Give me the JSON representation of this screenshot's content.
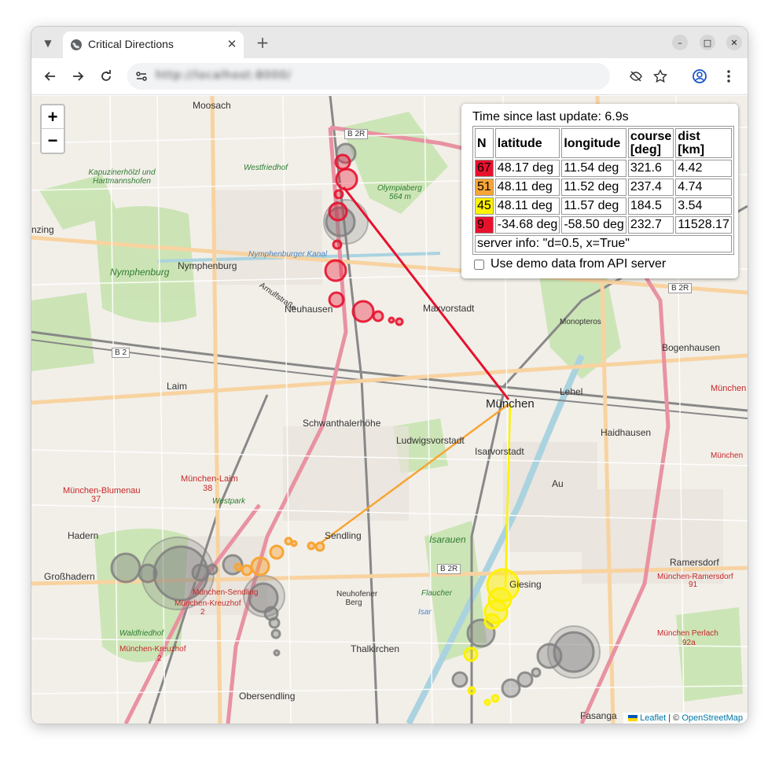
{
  "browser": {
    "tab_title": "Critical Directions",
    "url": "http://localhost:8000/"
  },
  "map": {
    "zoom_in": "+",
    "zoom_out": "−",
    "labels": [
      {
        "id": "moosach",
        "text": "Moosach",
        "cls": ""
      },
      {
        "id": "b2r-top",
        "text": "B 2R",
        "cls": "badge"
      },
      {
        "id": "westfriedhof",
        "text": "Westfriedhof",
        "cls": "park"
      },
      {
        "id": "kapuziner",
        "text": "Kapuzinerhölzl und Hartmannshofen",
        "cls": "park"
      },
      {
        "id": "olympiaberg",
        "text": "Olympiaberg",
        "cls": "park"
      },
      {
        "id": "olympiaberg-h",
        "text": "564 m",
        "cls": "park"
      },
      {
        "id": "nzing",
        "text": "nzing",
        "cls": ""
      },
      {
        "id": "nymphenburg",
        "text": "Nymphenburg",
        "cls": "city"
      },
      {
        "id": "nymphenburg-park",
        "text": "Nymphenburg",
        "cls": "park"
      },
      {
        "id": "nymph-kanal",
        "text": "Nymphenburger Kanal",
        "cls": "water"
      },
      {
        "id": "neuhausen",
        "text": "Neuhausen",
        "cls": ""
      },
      {
        "id": "arnulf",
        "text": "Arnulfstraße",
        "cls": ""
      },
      {
        "id": "maxvorstadt",
        "text": "Maxvorstadt",
        "cls": ""
      },
      {
        "id": "monopteros",
        "text": "Monopteros",
        "cls": ""
      },
      {
        "id": "b2r-right",
        "text": "B 2R",
        "cls": "badge"
      },
      {
        "id": "bogenhausen",
        "text": "Bogenhausen",
        "cls": ""
      },
      {
        "id": "b2",
        "text": "B 2",
        "cls": "badge"
      },
      {
        "id": "lehel",
        "text": "Lehel",
        "cls": ""
      },
      {
        "id": "muenchen-r",
        "text": "München",
        "cls": "rail"
      },
      {
        "id": "laim",
        "text": "Laim",
        "cls": ""
      },
      {
        "id": "muenchen",
        "text": "München",
        "cls": "city"
      },
      {
        "id": "schwanthaler",
        "text": "Schwanthalerhöhe",
        "cls": ""
      },
      {
        "id": "haidhausen",
        "text": "Haidhausen",
        "cls": ""
      },
      {
        "id": "ludwigsvorstadt",
        "text": "Ludwigsvorstadt",
        "cls": ""
      },
      {
        "id": "isarvorstadt",
        "text": "Isarvorstadt",
        "cls": ""
      },
      {
        "id": "au",
        "text": "Au",
        "cls": ""
      },
      {
        "id": "muenchen-laim",
        "text": "München-Laim",
        "cls": "rail"
      },
      {
        "id": "laim-38",
        "text": "38",
        "cls": "rail"
      },
      {
        "id": "westpark",
        "text": "Westpark",
        "cls": "park"
      },
      {
        "id": "blumenau",
        "text": "München-Blumenau",
        "cls": "rail"
      },
      {
        "id": "blumenau-37",
        "text": "37",
        "cls": "rail"
      },
      {
        "id": "hadern",
        "text": "Hadern",
        "cls": ""
      },
      {
        "id": "sendling",
        "text": "Sendling",
        "cls": ""
      },
      {
        "id": "isarauen",
        "text": "Isarauen",
        "cls": "park"
      },
      {
        "id": "grosshadern",
        "text": "Großhadern",
        "cls": ""
      },
      {
        "id": "b2r-bottom",
        "text": "B 2R",
        "cls": "badge"
      },
      {
        "id": "giesing",
        "text": "Giesing",
        "cls": ""
      },
      {
        "id": "ramersdorf",
        "text": "Ramersdorf",
        "cls": ""
      },
      {
        "id": "muenchen-ramersdorf",
        "text": "München-Ramersdorf",
        "cls": "rail"
      },
      {
        "id": "ramersdorf-91",
        "text": "91",
        "cls": "rail"
      },
      {
        "id": "muenchen-sendling",
        "text": "München-Sendling",
        "cls": "rail"
      },
      {
        "id": "muenchen-kreuzhof",
        "text": "München-Kreuzhof",
        "cls": "rail"
      },
      {
        "id": "kreuzhof-2",
        "text": "2",
        "cls": "rail"
      },
      {
        "id": "neuhofener",
        "text": "Neuhofener Berg",
        "cls": ""
      },
      {
        "id": "flaucher",
        "text": "Flaucher",
        "cls": "park"
      },
      {
        "id": "isar",
        "text": "Isar",
        "cls": "water"
      },
      {
        "id": "waldfriedhof",
        "text": "Waldfriedhof",
        "cls": "park"
      },
      {
        "id": "muenchen-kreuzhof2",
        "text": "München-Kreuzhof",
        "cls": "rail"
      },
      {
        "id": "kreuzhof2-2",
        "text": "2",
        "cls": "rail"
      },
      {
        "id": "muenchen-perlach",
        "text": "München Perlach",
        "cls": "rail"
      },
      {
        "id": "perlach-92a",
        "text": "92a",
        "cls": "rail"
      },
      {
        "id": "thalkirchen",
        "text": "Thalkirchen",
        "cls": ""
      },
      {
        "id": "obersendling",
        "text": "Obersendling",
        "cls": ""
      },
      {
        "id": "fasanga",
        "text": "Fasanga",
        "cls": ""
      },
      {
        "id": "muenchen-right",
        "text": "München",
        "cls": "rail"
      }
    ]
  },
  "info": {
    "update_text": "Time since last update: 6.9s",
    "headers": [
      "N",
      "latitude",
      "longitude",
      "course [deg]",
      "dist [km]"
    ],
    "rows": [
      {
        "n": "67",
        "color": "#e8112d",
        "lat": "48.17 deg",
        "lon": "11.54 deg",
        "course": "321.6",
        "dist": "4.42"
      },
      {
        "n": "51",
        "color": "#f7a536",
        "lat": "48.11 deg",
        "lon": "11.52 deg",
        "course": "237.4",
        "dist": "4.74"
      },
      {
        "n": "45",
        "color": "#fdf200",
        "lat": "48.11 deg",
        "lon": "11.57 deg",
        "course": "184.5",
        "dist": "3.54"
      },
      {
        "n": "9",
        "color": "#e8112d",
        "lat": "-34.68 deg",
        "lon": "-58.50 deg",
        "course": "232.7",
        "dist": "11528.17"
      }
    ],
    "server_info": "server info: \"d=0.5, x=True\"",
    "demo_label": "Use demo data from API server"
  },
  "attribution": {
    "leaflet": "Leaflet",
    "sep": " | © ",
    "osm": "OpenStreetMap"
  },
  "colors": {
    "track_red": "#e8112d",
    "track_orange": "#f7a536",
    "track_yellow": "#fdf200",
    "track_grey": "#808080"
  }
}
